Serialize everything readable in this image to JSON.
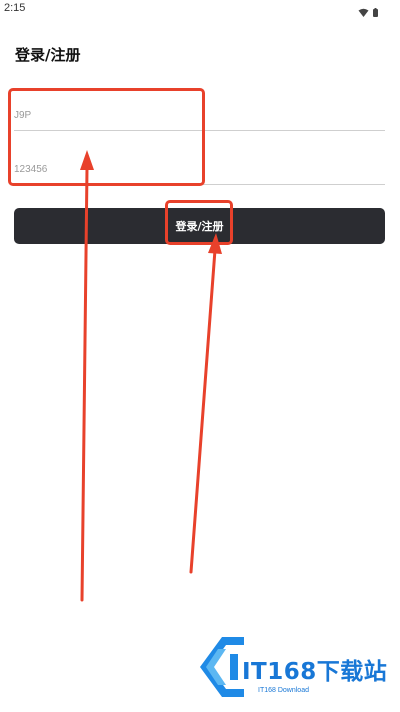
{
  "status_bar": {
    "time": "2:15",
    "icons": [
      "wifi-icon",
      "battery-icon"
    ]
  },
  "page": {
    "title": "登录/注册"
  },
  "form": {
    "username_value": "J9P",
    "password_value": "123456",
    "submit_label": "登录/注册"
  },
  "annotations": {
    "color": "#e8412b"
  },
  "watermark": {
    "text": "IT168下载站",
    "subtext": "IT168 Download",
    "color": "#1877d6"
  },
  "theme": {
    "button_color": "#2b2c31"
  }
}
